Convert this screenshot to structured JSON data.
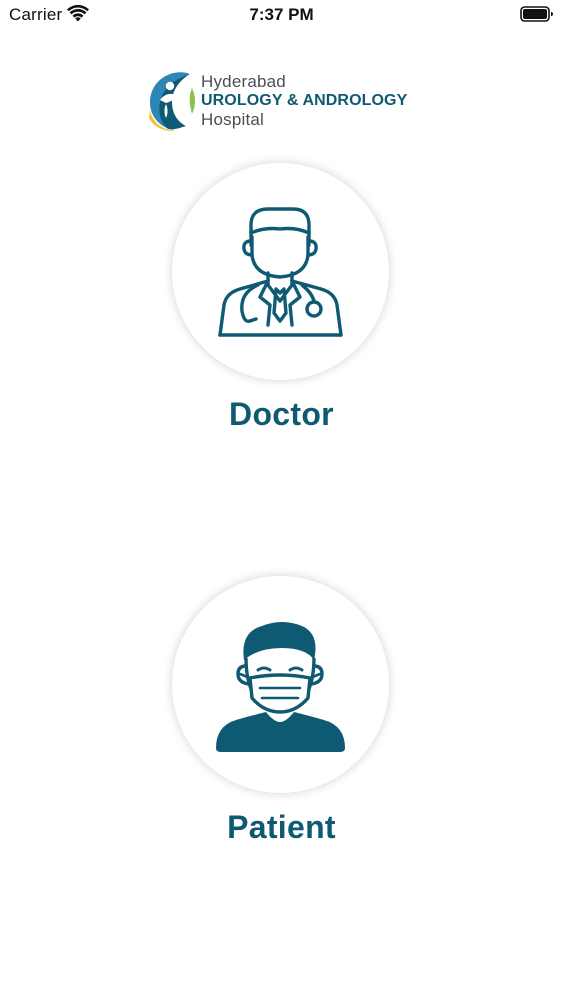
{
  "status_bar": {
    "carrier": "Carrier",
    "time": "7:37 PM",
    "wifi_icon": "wifi-icon",
    "battery_icon": "battery-icon"
  },
  "logo": {
    "line1": "Hyderabad",
    "line2": "UROLOGY & ANDROLOGY",
    "line3": "Hospital",
    "icon": "hospital-logo-icon"
  },
  "roles": [
    {
      "label": "Doctor",
      "icon": "doctor-icon"
    },
    {
      "label": "Patient",
      "icon": "patient-icon"
    }
  ],
  "colors": {
    "primary": "#0f5a73",
    "logo_yellow": "#f2c230",
    "logo_blue": "#2e86b5",
    "text_gray": "#4a4f55"
  }
}
